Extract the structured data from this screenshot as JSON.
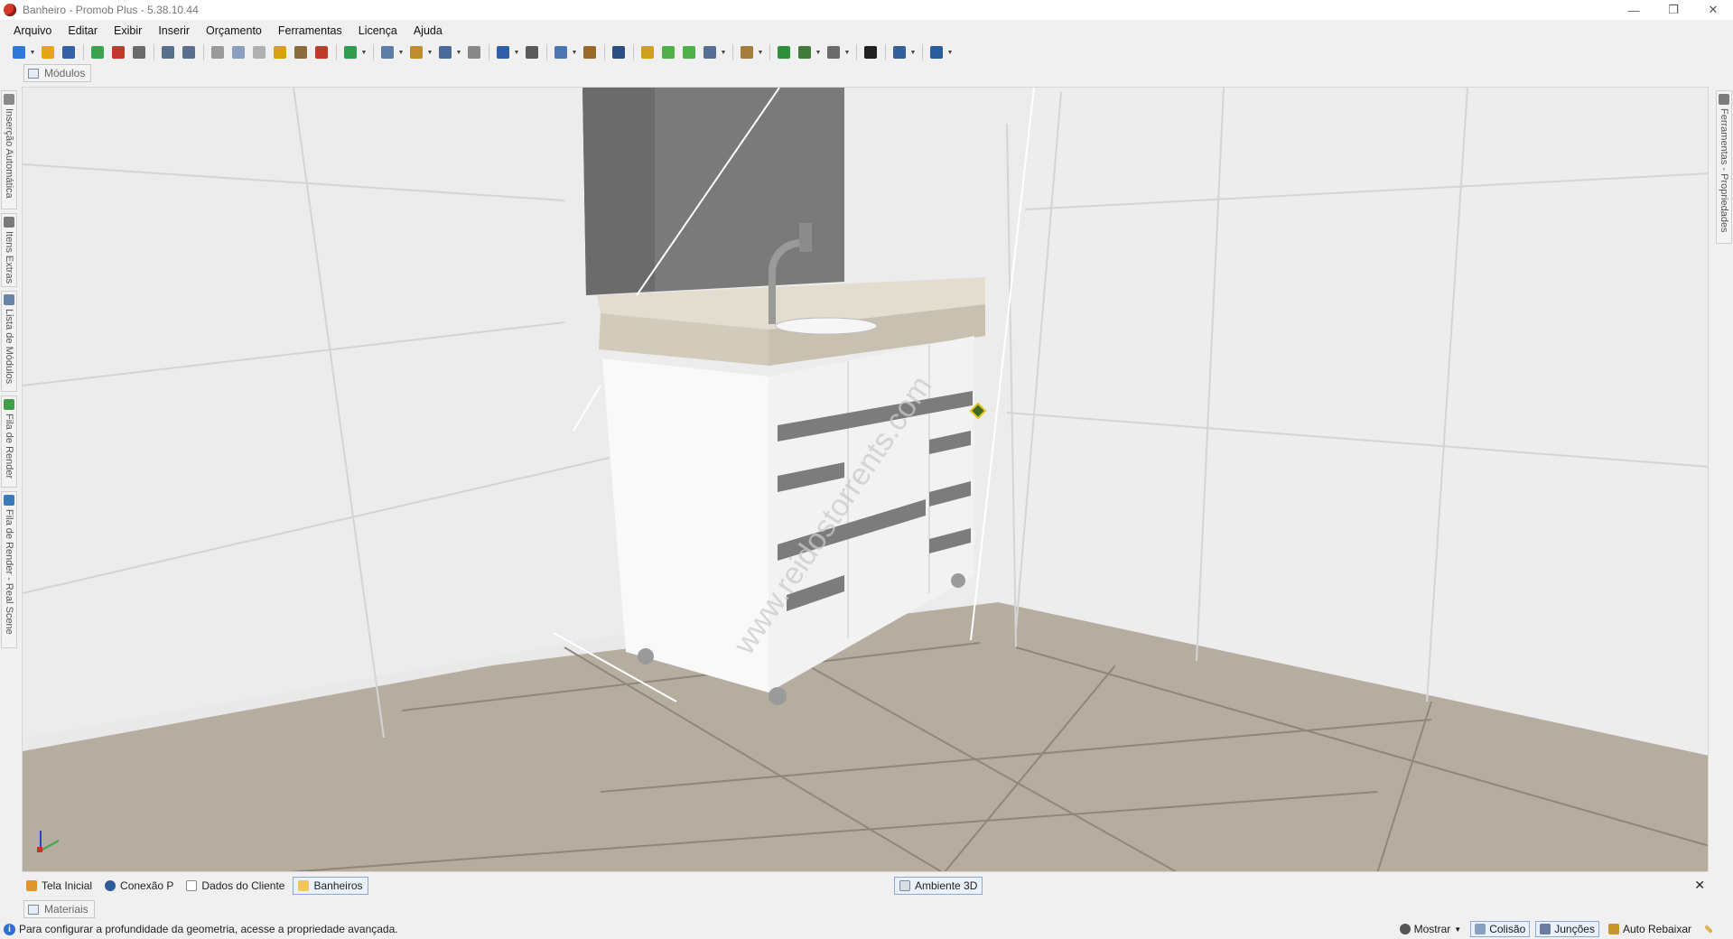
{
  "window": {
    "title": "Banheiro - Promob Plus - 5.38.10.44"
  },
  "window_controls": {
    "minimize": "—",
    "restore": "❐",
    "close": "✕"
  },
  "menu": [
    "Arquivo",
    "Editar",
    "Exibir",
    "Inserir",
    "Orçamento",
    "Ferramentas",
    "Licença",
    "Ajuda"
  ],
  "toolbar": {
    "icons": [
      "new-file-icon",
      "open-folder-icon",
      "save-icon",
      "sep",
      "render-icon",
      "render-settings-icon",
      "print-icon",
      "sep",
      "undo-icon",
      "redo-icon",
      "sep",
      "cut-icon",
      "copy-icon",
      "paste-icon",
      "paint-icon",
      "format-painter-icon",
      "delete-icon",
      "sep",
      "budget-icon",
      "sep",
      "group-icon",
      "align-icon",
      "shape-icon",
      "grid-icon",
      "sep",
      "select-pointer-icon",
      "measure-icon",
      "sep",
      "material-icon",
      "module-icon",
      "sep",
      "eye-view-icon",
      "sep",
      "rotate-icon",
      "move-left-icon",
      "move-right-icon",
      "view-box-icon",
      "sep",
      "cube-view-icon",
      "sep",
      "snap-icon",
      "camera-move-icon",
      "camera-icon",
      "sep",
      "pan-arrows-icon",
      "sep",
      "layout-icon",
      "sep",
      "panels-icon"
    ],
    "colors": [
      "#2f7ad8",
      "#e8a317",
      "#3461a8",
      "",
      "#3aa34f",
      "#c0392b",
      "#6b6b6b",
      "",
      "#5a6f8c",
      "#5a6f8c",
      "",
      "#9a9a9a",
      "#8a9fc0",
      "#b0b0b0",
      "#d9a012",
      "#8a6d3b",
      "#c0392b",
      "",
      "#2e9b4f",
      "",
      "#5e7da6",
      "#c08a2e",
      "#4a6a9a",
      "#888888",
      "",
      "#2f5fa8",
      "#5a5a5a",
      "",
      "#4d77b3",
      "#9a6a2a",
      "",
      "#2a4f80",
      "",
      "#d1a019",
      "#4fb04a",
      "#4fb04a",
      "#566f94",
      "",
      "#a67c3d",
      "",
      "#2f8e3c",
      "#417a3c",
      "#6b6b6b",
      "",
      "#222222",
      "",
      "#355f9c",
      "",
      "#2a5d9e"
    ]
  },
  "panels": {
    "modules_tab": "Módulos",
    "materials_tab": "Materiais"
  },
  "left_sidebar": [
    {
      "label": "Inserção Automática",
      "icon": "auto-insert-icon"
    },
    {
      "label": "Itens Extras",
      "icon": "extra-items-icon"
    },
    {
      "label": "Lista de Módulos",
      "icon": "module-list-icon"
    },
    {
      "label": "Fila de Render",
      "icon": "render-queue-icon"
    },
    {
      "label": "Fila de Render - Real Scene",
      "icon": "render-real-scene-icon"
    }
  ],
  "right_sidebar": [
    {
      "label": "Ferramentas - Propriedades",
      "icon": "tools-icon"
    }
  ],
  "viewport": {
    "watermark": "www.reidostorrents.com",
    "colors": {
      "wall": "#ececec",
      "floor": "#b5ad9f",
      "cabinet": "#f7f7f7",
      "countertop": "#d9d3c4",
      "backsplash": "#7a7a7a",
      "handle": "#7c7c7c"
    }
  },
  "doc_tabs": [
    {
      "label": "Tela Inicial",
      "icon": "home-icon",
      "active": false
    },
    {
      "label": "Conexão P",
      "icon": "connection-icon",
      "active": false
    },
    {
      "label": "Dados do Cliente",
      "icon": "client-data-icon",
      "active": false
    },
    {
      "label": "Banheiros",
      "icon": "folder-icon",
      "active": true
    }
  ],
  "environment_tab": {
    "label": "Ambiente 3D",
    "close": "✕"
  },
  "status": {
    "info_text": "Para configurar a profundidade da geometria, acesse a propriedade avançada.",
    "show_label": "Mostrar",
    "collision_label": "Colisão",
    "junctions_label": "Junções",
    "auto_lower_label": "Auto Rebaixar"
  }
}
